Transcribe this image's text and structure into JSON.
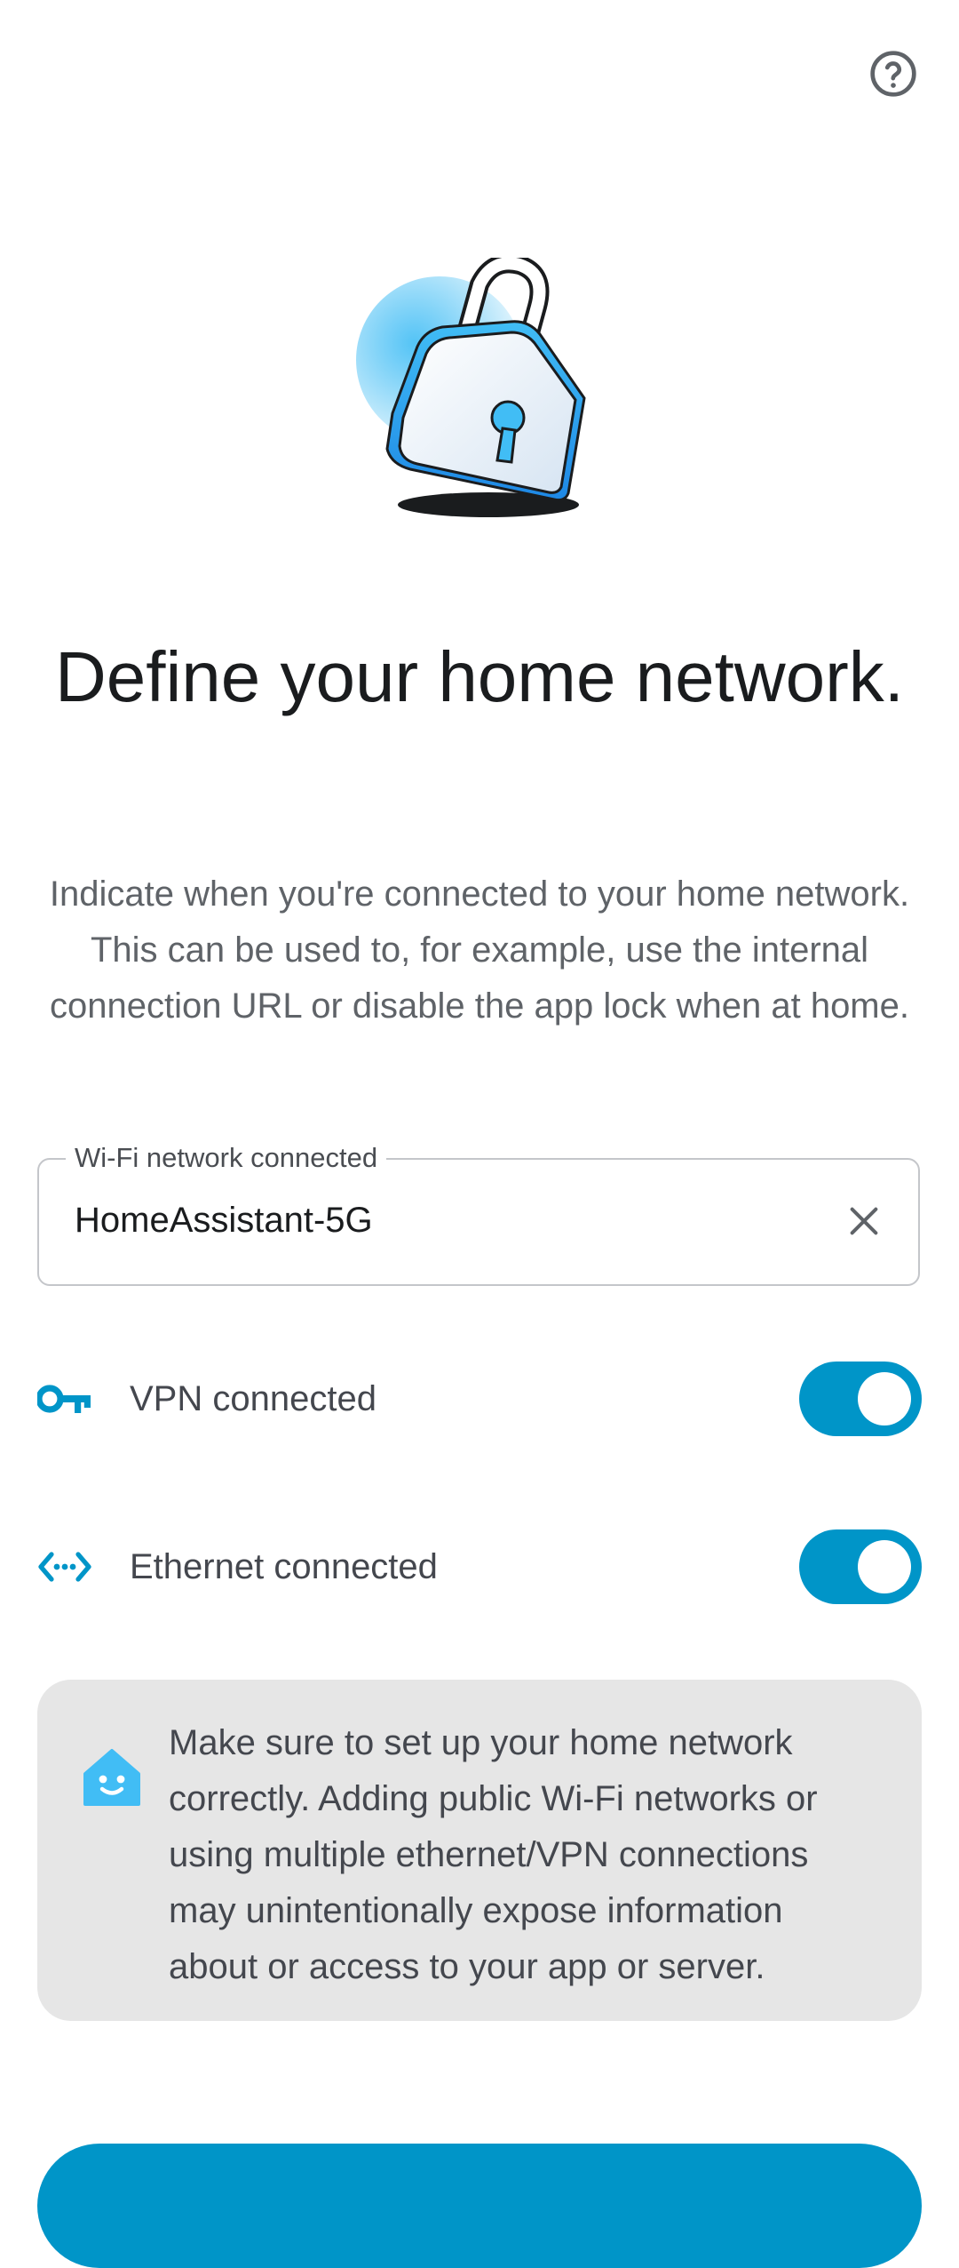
{
  "header": {
    "help_icon": "help-circle-icon"
  },
  "hero": {
    "image": "padlock-illustration",
    "accent_color": "#41bdf5"
  },
  "title": "Define your home network.",
  "description": "Indicate when you're connected to your home network. This can be used to, for example, use the internal connection URL or disable the app lock when at home.",
  "wifi_field": {
    "label": "Wi-Fi network connected",
    "value": "HomeAssistant-5G",
    "clear_icon": "close-icon"
  },
  "vpn": {
    "icon": "key-icon",
    "label": "VPN connected",
    "enabled": true
  },
  "ethernet": {
    "icon": "ethernet-icon",
    "label": "Ethernet connected",
    "enabled": true
  },
  "notice": {
    "icon": "home-assistant-icon",
    "text": "Make sure to set up your home network correctly. Adding public Wi-Fi networks or using multiple ethernet/VPN connections may unintentionally expose information about or access to your app or server."
  },
  "colors": {
    "primary": "#0095c8",
    "notice_bg": "#e6e6e6"
  }
}
